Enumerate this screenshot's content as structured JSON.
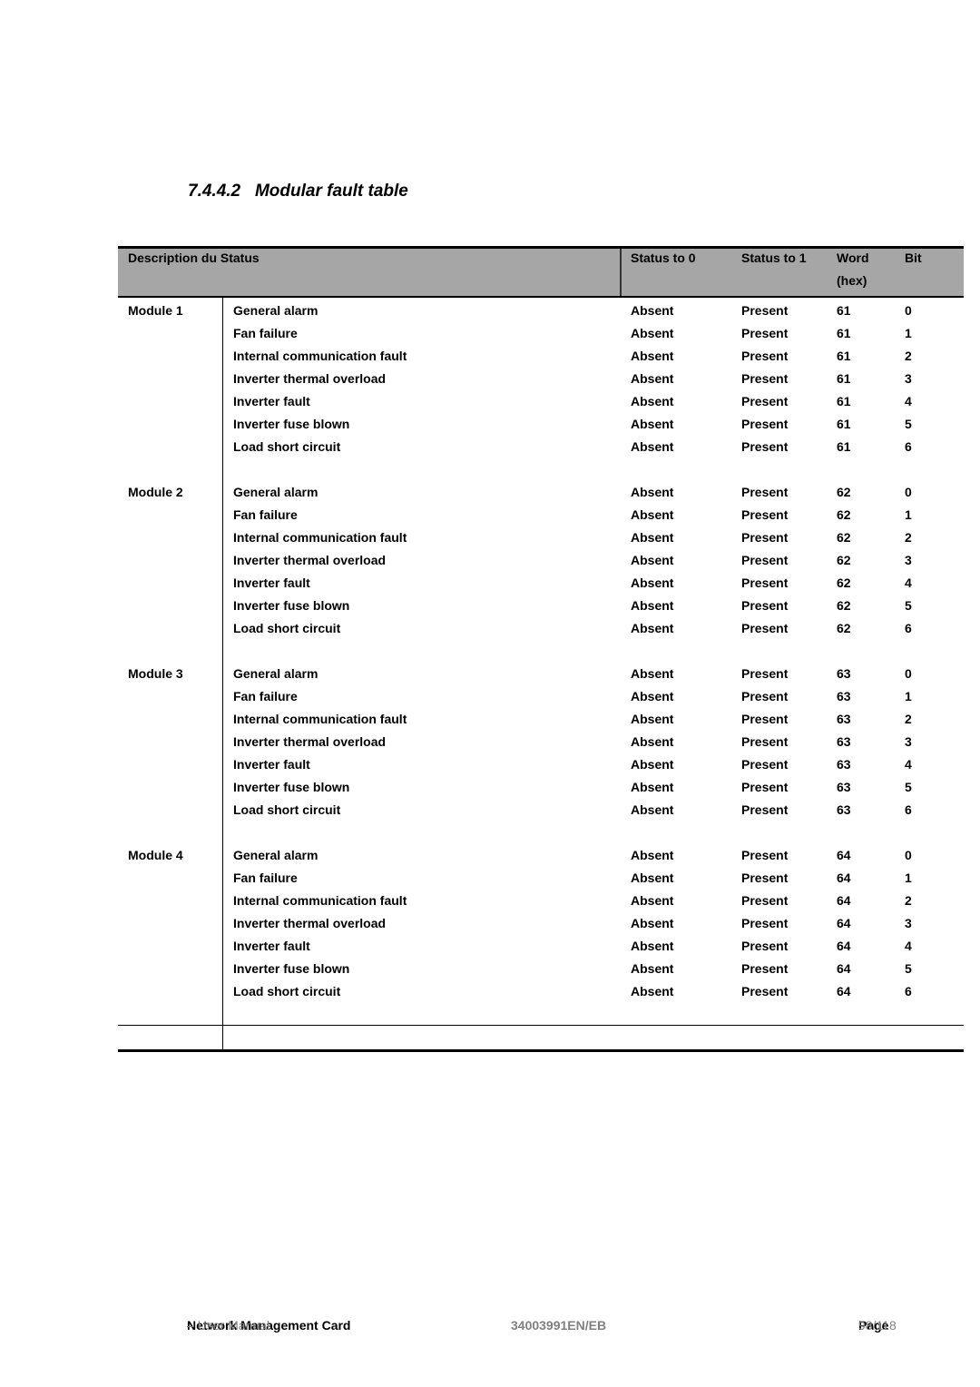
{
  "section": {
    "number": "7.4.4.2",
    "title": "Modular fault table"
  },
  "table": {
    "headers": {
      "description": "Description du Status",
      "status0": "Status to 0",
      "status1": "Status to 1",
      "word": "Word",
      "word_sub": "(hex)",
      "bit": "Bit"
    },
    "rows": [
      {
        "module": "Module 1",
        "desc": "General alarm",
        "s0": "Absent",
        "s1": "Present",
        "word": "61",
        "bit": "0"
      },
      {
        "module": "",
        "desc": "Fan failure",
        "s0": "Absent",
        "s1": "Present",
        "word": "61",
        "bit": "1"
      },
      {
        "module": "",
        "desc": "Internal communication fault",
        "s0": "Absent",
        "s1": "Present",
        "word": "61",
        "bit": "2"
      },
      {
        "module": "",
        "desc": "Inverter thermal overload",
        "s0": "Absent",
        "s1": "Present",
        "word": "61",
        "bit": "3"
      },
      {
        "module": "",
        "desc": "Inverter fault",
        "s0": "Absent",
        "s1": "Present",
        "word": "61",
        "bit": "4"
      },
      {
        "module": "",
        "desc": "Inverter fuse blown",
        "s0": "Absent",
        "s1": "Present",
        "word": "61",
        "bit": "5"
      },
      {
        "module": "",
        "desc": "Load short circuit",
        "s0": "Absent",
        "s1": "Present",
        "word": "61",
        "bit": "6"
      },
      {
        "module": "Module 2",
        "desc": "General alarm",
        "s0": "Absent",
        "s1": "Present",
        "word": "62",
        "bit": "0"
      },
      {
        "module": "",
        "desc": "Fan failure",
        "s0": "Absent",
        "s1": "Present",
        "word": "62",
        "bit": "1"
      },
      {
        "module": "",
        "desc": "Internal communication fault",
        "s0": "Absent",
        "s1": "Present",
        "word": "62",
        "bit": "2"
      },
      {
        "module": "",
        "desc": "Inverter thermal overload",
        "s0": "Absent",
        "s1": "Present",
        "word": "62",
        "bit": "3"
      },
      {
        "module": "",
        "desc": "Inverter fault",
        "s0": "Absent",
        "s1": "Present",
        "word": "62",
        "bit": "4"
      },
      {
        "module": "",
        "desc": "Inverter fuse blown",
        "s0": "Absent",
        "s1": "Present",
        "word": "62",
        "bit": "5"
      },
      {
        "module": "",
        "desc": "Load short circuit",
        "s0": "Absent",
        "s1": "Present",
        "word": "62",
        "bit": "6"
      },
      {
        "module": "Module 3",
        "desc": "General alarm",
        "s0": "Absent",
        "s1": "Present",
        "word": "63",
        "bit": "0"
      },
      {
        "module": "",
        "desc": "Fan failure",
        "s0": "Absent",
        "s1": "Present",
        "word": "63",
        "bit": "1"
      },
      {
        "module": "",
        "desc": "Internal communication fault",
        "s0": "Absent",
        "s1": "Present",
        "word": "63",
        "bit": "2"
      },
      {
        "module": "",
        "desc": "Inverter thermal overload",
        "s0": "Absent",
        "s1": "Present",
        "word": "63",
        "bit": "3"
      },
      {
        "module": "",
        "desc": "Inverter fault",
        "s0": "Absent",
        "s1": "Present",
        "word": "63",
        "bit": "4"
      },
      {
        "module": "",
        "desc": "Inverter fuse blown",
        "s0": "Absent",
        "s1": "Present",
        "word": "63",
        "bit": "5"
      },
      {
        "module": "",
        "desc": "Load short circuit",
        "s0": "Absent",
        "s1": "Present",
        "word": "63",
        "bit": "6"
      },
      {
        "module": "Module 4",
        "desc": "General alarm",
        "s0": "Absent",
        "s1": "Present",
        "word": "64",
        "bit": "0"
      },
      {
        "module": "",
        "desc": "Fan failure",
        "s0": "Absent",
        "s1": "Present",
        "word": "64",
        "bit": "1"
      },
      {
        "module": "",
        "desc": "Internal communication fault",
        "s0": "Absent",
        "s1": "Present",
        "word": "64",
        "bit": "2"
      },
      {
        "module": "",
        "desc": "Inverter thermal overload",
        "s0": "Absent",
        "s1": "Present",
        "word": "64",
        "bit": "3"
      },
      {
        "module": "",
        "desc": "Inverter fault",
        "s0": "Absent",
        "s1": "Present",
        "word": "64",
        "bit": "4"
      },
      {
        "module": "",
        "desc": "Inverter fuse blown",
        "s0": "Absent",
        "s1": "Present",
        "word": "64",
        "bit": "5"
      },
      {
        "module": "",
        "desc": "Load short circuit",
        "s0": "Absent",
        "s1": "Present",
        "word": "64",
        "bit": "6"
      }
    ]
  },
  "footer": {
    "title": "Network Management Card",
    "subtitle": " – User Manual",
    "doc_ref": "34003991EN/EB",
    "page_label": "Page",
    "page_num": " 98/118"
  },
  "colors": {
    "header_bg": "#a6a6a6",
    "footer_gray": "#808080"
  }
}
